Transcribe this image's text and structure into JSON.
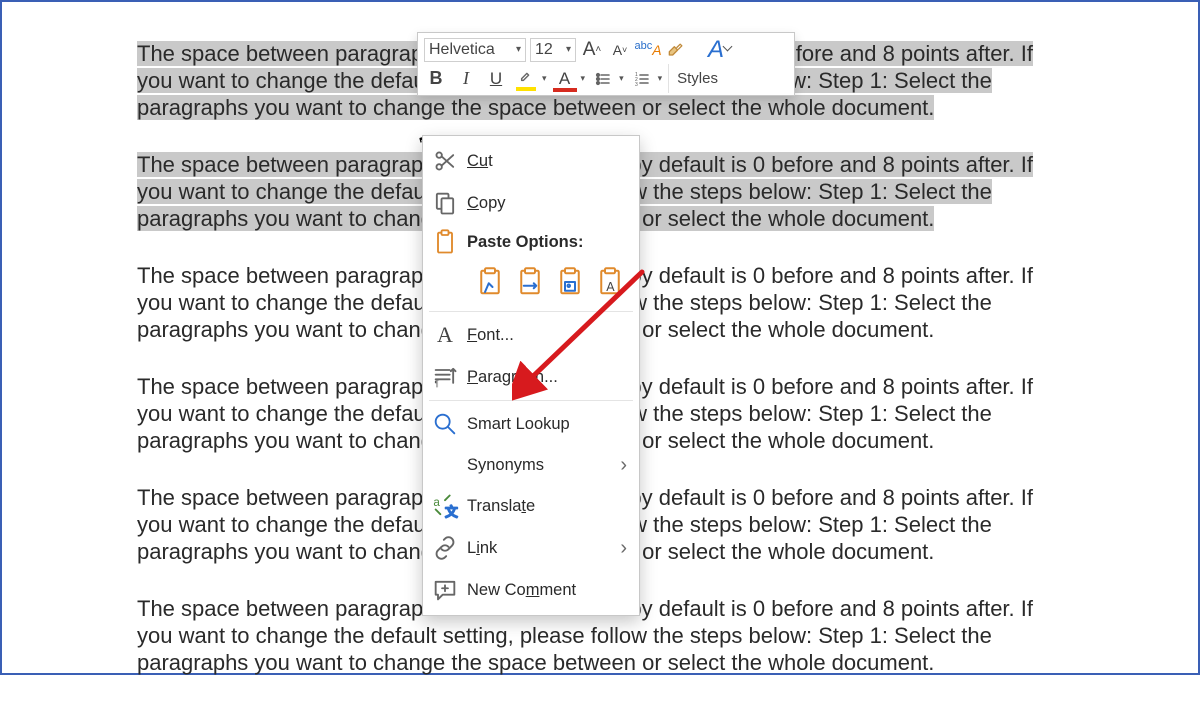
{
  "document": {
    "paragraph_text": "The space between paragraphs in Microsoft Word by default is 0 before and 8 points after. If you want to change the default setting, please follow the steps below: Step 1: Select the paragraphs you want to change the space between or select the whole document."
  },
  "mini_toolbar": {
    "font_name": "Helvetica",
    "font_size": "12",
    "styles_label": "Styles"
  },
  "context_menu": {
    "cut": "Cut",
    "copy": "Copy",
    "paste_options": "Paste Options:",
    "font": "Font...",
    "paragraph": "Paragraph...",
    "smart_lookup": "Smart Lookup",
    "synonyms": "Synonyms",
    "translate": "Translate",
    "link": "Link",
    "new_comment": "New Comment"
  }
}
